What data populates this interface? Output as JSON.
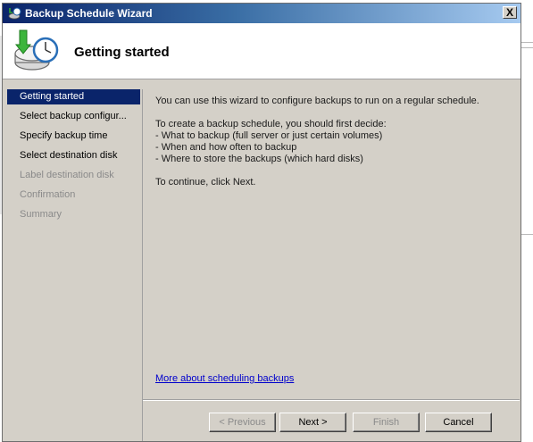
{
  "window": {
    "title": "Backup Schedule Wizard",
    "close_label": "X"
  },
  "header": {
    "title": "Getting started",
    "icon": "backup-schedule-icon"
  },
  "nav": {
    "items": [
      {
        "label": "Getting started",
        "state": "active"
      },
      {
        "label": "Select backup configur...",
        "state": "enabled"
      },
      {
        "label": "Specify backup time",
        "state": "enabled"
      },
      {
        "label": "Select destination disk",
        "state": "enabled"
      },
      {
        "label": "Label destination disk",
        "state": "disabled"
      },
      {
        "label": "Confirmation",
        "state": "disabled"
      },
      {
        "label": "Summary",
        "state": "disabled"
      }
    ]
  },
  "content": {
    "intro": "You can use this wizard to configure backups to run on a regular schedule.",
    "decide_heading": "To create a backup schedule, you should first decide:",
    "bullets": [
      "-  What to backup (full server or just certain volumes)",
      "-  When and how often to backup",
      "-  Where to store the backups (which hard disks)"
    ],
    "continue_text": "To continue, click Next.",
    "more_link": "More about scheduling backups"
  },
  "buttons": {
    "previous": "< Previous",
    "next": "Next >",
    "finish": "Finish",
    "cancel": "Cancel"
  },
  "colors": {
    "active_nav": "#0a246a",
    "window_face": "#d4d0c8",
    "link": "#0000cc"
  }
}
